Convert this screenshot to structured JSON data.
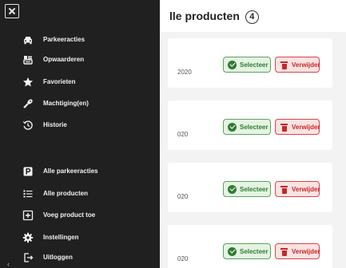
{
  "page": {
    "title": "lle producten",
    "count": "4",
    "cards": [
      {
        "date": "2020",
        "select_label": "Selecteer",
        "delete_label": "Verwijder"
      },
      {
        "date": "020",
        "select_label": "Selecteer",
        "delete_label": "Verwijder"
      },
      {
        "date": "020",
        "select_label": "Selecteer",
        "delete_label": "Verwijder"
      },
      {
        "date": "020",
        "select_label": "Selecteer",
        "delete_label": "Verwijder"
      }
    ]
  },
  "menu": {
    "close_icon": "close-icon",
    "items": [
      {
        "label": "Parkeeracties",
        "icon": "car-icon"
      },
      {
        "label": "Opwaarderen",
        "icon": "wallet-icon"
      },
      {
        "label": "Favorieten",
        "icon": "star-icon"
      },
      {
        "label": "Machtiging(en)",
        "icon": "key-icon"
      },
      {
        "label": "Historie",
        "icon": "history-icon"
      },
      {
        "label": "Alle parkeeracties",
        "icon": "parking-icon"
      },
      {
        "label": "Alle producten",
        "icon": "list-icon"
      },
      {
        "label": "Voeg product toe",
        "icon": "plus-box-icon"
      },
      {
        "label": "Instellingen",
        "icon": "gear-icon"
      },
      {
        "label": "Uitloggen",
        "icon": "logout-icon"
      }
    ]
  },
  "colors": {
    "menu_bg": "#202020",
    "select_green": "#2e7d32",
    "delete_red": "#c62828"
  }
}
